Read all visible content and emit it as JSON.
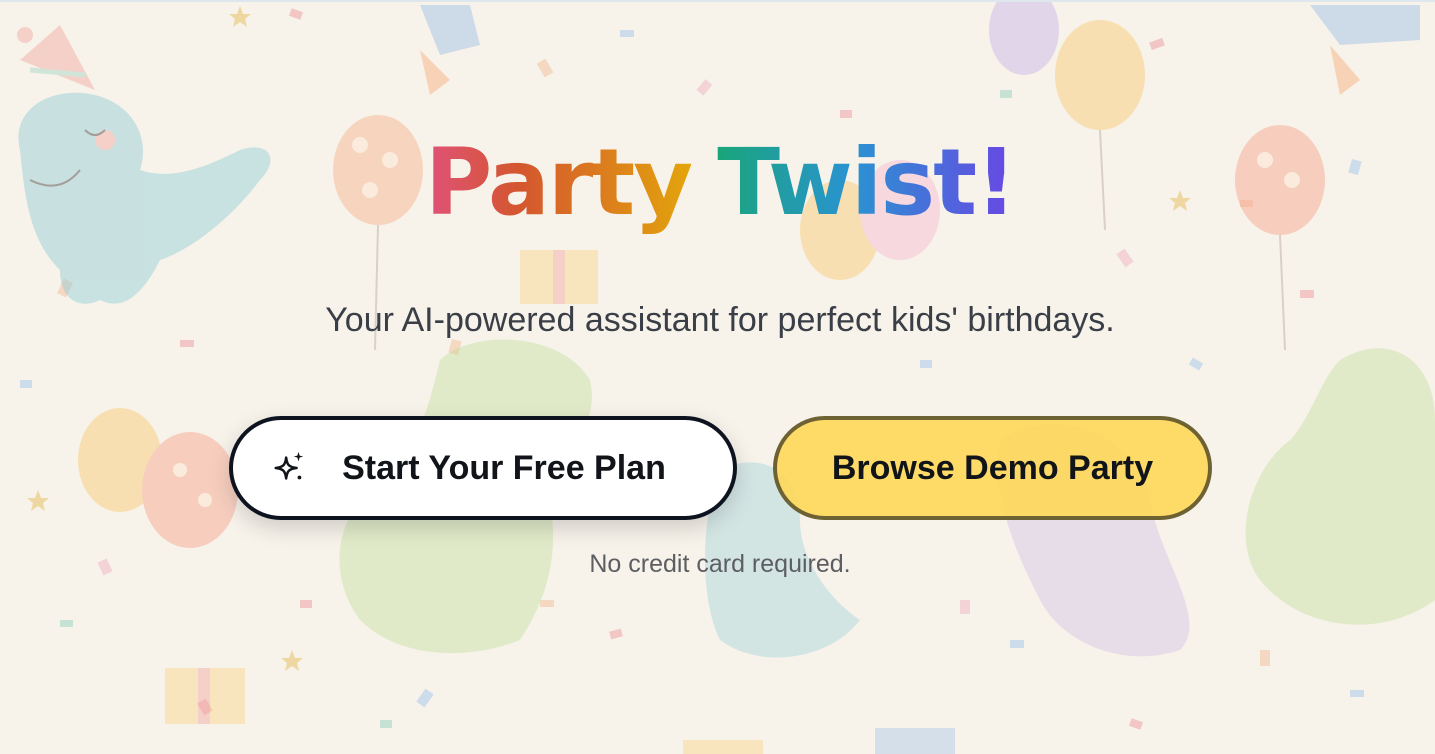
{
  "hero": {
    "title_word1": "Party",
    "title_word2": "Twist!",
    "subtitle": "Your AI-powered assistant for perfect kids' birthdays.",
    "primary_button_label": "Start Your Free Plan",
    "secondary_button_label": "Browse Demo Party",
    "note": "No credit card required."
  },
  "icons": {
    "primary_button_icon": "sparkles-icon"
  },
  "colors": {
    "page_background": "#f7f3ea",
    "primary_button_bg": "#ffffff",
    "primary_button_border": "#0e1320",
    "secondary_button_bg": "#ffd652",
    "secondary_button_border": "#6e6233",
    "title_gradient_word1": [
      "#e0527a",
      "#d4562f",
      "#e3a50b"
    ],
    "title_gradient_word2": [
      "#1aa57a",
      "#2a93d1",
      "#6a46e4"
    ]
  }
}
